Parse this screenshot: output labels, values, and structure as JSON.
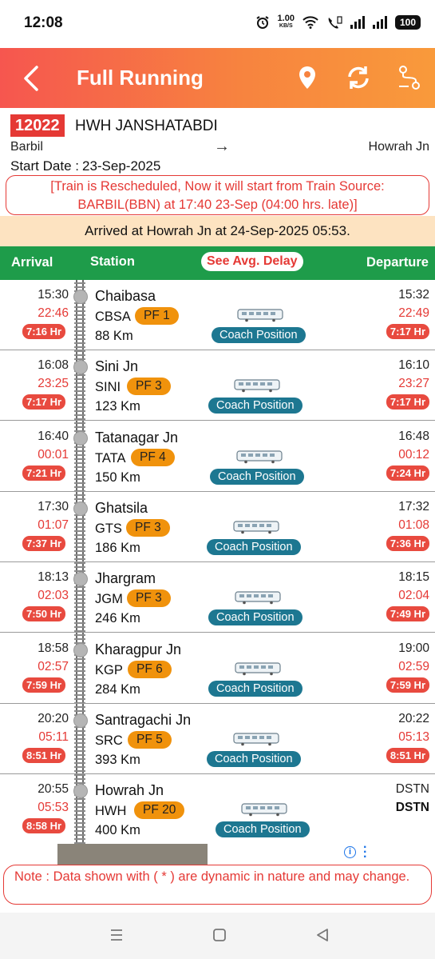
{
  "status_bar": {
    "time": "12:08",
    "net_speed_value": "1.00",
    "net_speed_unit": "KB/S",
    "battery": "100"
  },
  "app_bar": {
    "title": "Full Running",
    "icons": [
      "back-arrow-icon",
      "location-pin-icon",
      "refresh-icon",
      "route-icon"
    ]
  },
  "train": {
    "number": "12022",
    "name": "HWH JANSHATABDI",
    "from": "Barbil",
    "arrow": "→",
    "to": "Howrah Jn",
    "start_date_label": "Start Date :",
    "start_date": "23-Sep-2025"
  },
  "reschedule_notice": {
    "line1": "[Train is Rescheduled, Now it will start from Train Source:",
    "line2": "BARBIL(BBN) at 17:40 23-Sep (04:00 hrs. late)]"
  },
  "arrived_banner": "Arrived at Howrah Jn at 24-Sep-2025 05:53.",
  "table_header": {
    "arrival": "Arrival",
    "station": "Station",
    "avg_delay_button": "See Avg. Delay",
    "departure": "Departure"
  },
  "coach_button_label": "Coach Position",
  "stations": [
    {
      "name": "Chaibasa",
      "code": "CBSA",
      "pf": "PF 1",
      "km": "88 Km",
      "arr_sched": "15:30",
      "arr_act": "22:46",
      "arr_delay": "7:16 Hr",
      "dep_sched": "15:32",
      "dep_act": "22:49",
      "dep_delay": "7:17 Hr"
    },
    {
      "name": "Sini Jn",
      "code": "SINI",
      "pf": "PF 3",
      "km": "123 Km",
      "arr_sched": "16:08",
      "arr_act": "23:25",
      "arr_delay": "7:17 Hr",
      "dep_sched": "16:10",
      "dep_act": "23:27",
      "dep_delay": "7:17 Hr"
    },
    {
      "name": "Tatanagar Jn",
      "code": "TATA",
      "pf": "PF 4",
      "km": "150 Km",
      "arr_sched": "16:40",
      "arr_act": "00:01",
      "arr_delay": "7:21 Hr",
      "dep_sched": "16:48",
      "dep_act": "00:12",
      "dep_delay": "7:24 Hr"
    },
    {
      "name": "Ghatsila",
      "code": "GTS",
      "pf": "PF 3",
      "km": "186 Km",
      "arr_sched": "17:30",
      "arr_act": "01:07",
      "arr_delay": "7:37 Hr",
      "dep_sched": "17:32",
      "dep_act": "01:08",
      "dep_delay": "7:36 Hr"
    },
    {
      "name": "Jhargram",
      "code": "JGM",
      "pf": "PF 3",
      "km": "246 Km",
      "arr_sched": "18:13",
      "arr_act": "02:03",
      "arr_delay": "7:50 Hr",
      "dep_sched": "18:15",
      "dep_act": "02:04",
      "dep_delay": "7:49 Hr"
    },
    {
      "name": "Kharagpur Jn",
      "code": "KGP",
      "pf": "PF 6",
      "km": "284 Km",
      "arr_sched": "18:58",
      "arr_act": "02:57",
      "arr_delay": "7:59 Hr",
      "dep_sched": "19:00",
      "dep_act": "02:59",
      "dep_delay": "7:59 Hr"
    },
    {
      "name": "Santragachi Jn",
      "code": "SRC",
      "pf": "PF 5",
      "km": "393 Km",
      "arr_sched": "20:20",
      "arr_act": "05:11",
      "arr_delay": "8:51 Hr",
      "dep_sched": "20:22",
      "dep_act": "05:13",
      "dep_delay": "8:51 Hr"
    },
    {
      "name": "Howrah Jn",
      "code": "HWH",
      "pf": "PF 20",
      "km": "400 Km",
      "arr_sched": "20:55",
      "arr_act": "05:53",
      "arr_delay": "8:58 Hr",
      "dep_sched": "DSTN",
      "dep_act": "DSTN"
    }
  ],
  "note": "Note : Data shown with ( * ) are dynamic in nature and may change.",
  "nav_bar": {
    "icons": [
      "recents-icon",
      "home-icon",
      "back-icon"
    ]
  },
  "colors": {
    "accent_red": "#e53935",
    "header_green": "#1e9c4a",
    "pf_orange": "#f0920c",
    "coach_teal": "#1d7791",
    "banner_peach": "#fde3c1"
  }
}
